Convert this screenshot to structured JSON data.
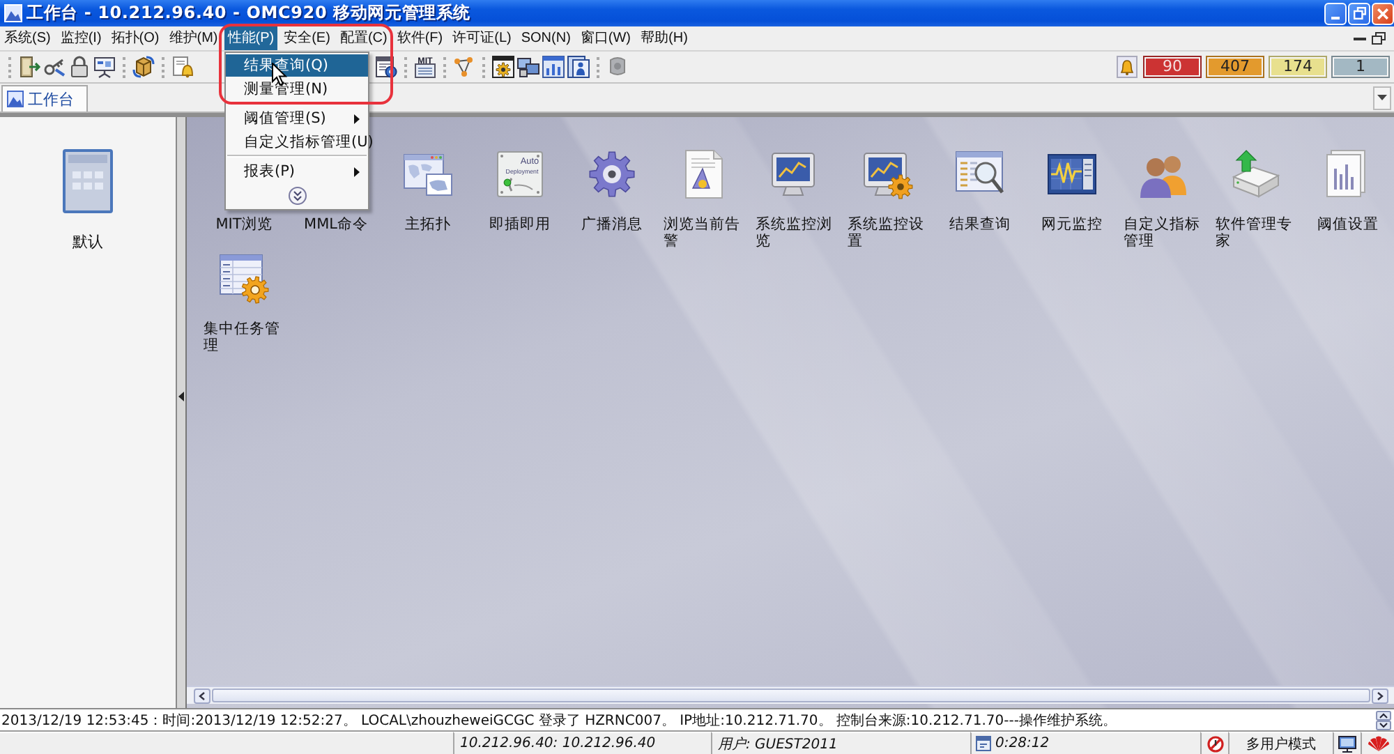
{
  "window": {
    "title": "工作台 - 10.212.96.40 - OMC920 移动网元管理系统"
  },
  "menu_bar": [
    {
      "label": "系统(S)",
      "selected": false
    },
    {
      "label": "监控(I)",
      "selected": false
    },
    {
      "label": "拓扑(O)",
      "selected": false
    },
    {
      "label": "维护(M)",
      "selected": false
    },
    {
      "label": "性能(P)",
      "selected": true
    },
    {
      "label": "安全(E)",
      "selected": false
    },
    {
      "label": "配置(C)",
      "selected": false
    },
    {
      "label": "软件(F)",
      "selected": false
    },
    {
      "label": "许可证(L)",
      "selected": false
    },
    {
      "label": "SON(N)",
      "selected": false
    },
    {
      "label": "窗口(W)",
      "selected": false
    },
    {
      "label": "帮助(H)",
      "selected": false
    }
  ],
  "toolbar": {
    "icon_text": "MIT",
    "alarm_counts": [
      {
        "count": "90",
        "color": "#cc3333"
      },
      {
        "count": "407",
        "color": "#e39a2d"
      },
      {
        "count": "174",
        "color": "#e8e08e"
      },
      {
        "count": "1",
        "color": "#a3b8c3"
      }
    ]
  },
  "tabs": [
    {
      "label": "工作台",
      "selected": true
    }
  ],
  "open_menu": [
    {
      "kind": "item",
      "label": "结果查询(Q)",
      "selected": true,
      "submenu": false
    },
    {
      "kind": "item",
      "label": "测量管理(N)",
      "selected": false,
      "submenu": false
    },
    {
      "kind": "separator"
    },
    {
      "kind": "item",
      "label": "阈值管理(S)",
      "selected": false,
      "submenu": true
    },
    {
      "kind": "item",
      "label": "自定义指标管理(U)",
      "selected": false,
      "submenu": false
    },
    {
      "kind": "separator"
    },
    {
      "kind": "item",
      "label": "报表(P)",
      "selected": false,
      "submenu": true
    },
    {
      "kind": "expand"
    }
  ],
  "left_panel": {
    "groups": [
      {
        "label": "默认",
        "selected": true
      }
    ]
  },
  "desktop": {
    "shortcuts": [
      {
        "label": "MIT浏览"
      },
      {
        "label": "MML命令"
      },
      {
        "label": "主拓扑"
      },
      {
        "label": "即插即用",
        "icon_text": [
          "Auto",
          "Deployment"
        ]
      },
      {
        "label": "广播消息"
      },
      {
        "label": "浏览当前告警"
      },
      {
        "label": "系统监控浏览"
      },
      {
        "label": "系统监控设置"
      },
      {
        "label": "结果查询"
      },
      {
        "label": "网元监控"
      },
      {
        "label": "自定义指标管理"
      },
      {
        "label": "软件管理专家"
      },
      {
        "label": "阈值设置"
      },
      {
        "label": "集中任务管理"
      }
    ]
  },
  "message_line": "2013/12/19 12:53:45：时间:2013/12/19 12:52:27。 LOCAL\\zhouzheweiGCGC 登录了 HZRNC007。 IP地址:10.212.71.70。 控制台来源:10.212.71.70---操作维护系统。",
  "status_bar": {
    "server": "10.212.96.40: 10.212.96.40",
    "user": "用户: GUEST2011",
    "session_time": "0:28:12",
    "mode": "多用户模式"
  }
}
